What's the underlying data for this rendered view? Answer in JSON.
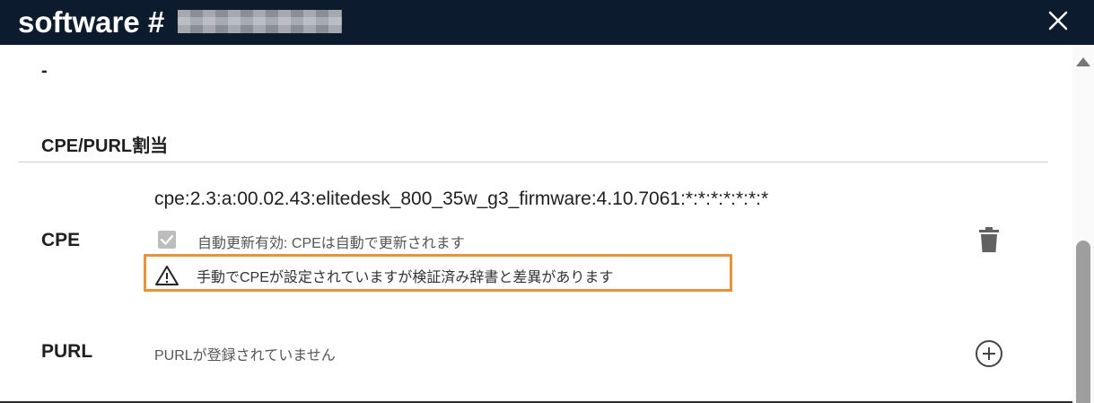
{
  "window": {
    "title": "software #"
  },
  "content": {
    "dash": "-",
    "section_title": "CPE/PURL割当",
    "cpe": {
      "label": "CPE",
      "value": "cpe:2.3:a:00.02.43:elitedesk_800_35w_g3_firmware:4.10.7061:*:*:*:*:*:*:*",
      "auto_update_text": "自動更新有効: CPEは自動で更新されます",
      "warning_text": "手動でCPEが設定されていますが検証済み辞書と差異があります"
    },
    "purl": {
      "label": "PURL",
      "empty_text": "PURLが登録されていません"
    }
  },
  "icons": {
    "close": "close-icon",
    "check": "checkbox-checked-icon",
    "warning": "warning-triangle-icon",
    "delete": "trash-icon",
    "add": "add-circle-icon",
    "scroll_up": "scroll-up-arrow-icon"
  },
  "colors": {
    "titlebar": "#0d1b2e",
    "highlight_border": "#e8923a",
    "checkbox": "#bdbdbd"
  }
}
